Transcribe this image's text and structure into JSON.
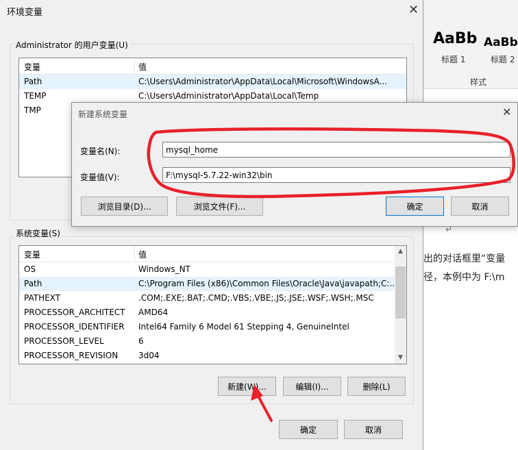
{
  "word": {
    "styles": [
      {
        "sample": "AaBb",
        "name": "标题 1"
      },
      {
        "sample": "AaBb",
        "name": "标题 2"
      }
    ],
    "group_label": "样式",
    "text_line1": "出的对话框里“变量",
    "text_line2": "径，本例中为 F:\\m"
  },
  "env": {
    "title": "环境变量",
    "user_group_label": "Administrator 的用户变量(U)",
    "columns": {
      "var": "变量",
      "val": "值"
    },
    "user_vars": [
      {
        "name": "Path",
        "value": "C:\\Users\\Administrator\\AppData\\Local\\Microsoft\\WindowsA..."
      },
      {
        "name": "TEMP",
        "value": "C:\\Users\\Administrator\\AppData\\Local\\Temp"
      },
      {
        "name": "TMP",
        "value": ""
      }
    ],
    "system_group_label": "系统变量(S)",
    "system_vars": [
      {
        "name": "OS",
        "value": "Windows_NT"
      },
      {
        "name": "Path",
        "value": "C:\\Program Files (x86)\\Common Files\\Oracle\\Java\\javapath;C:..."
      },
      {
        "name": "PATHEXT",
        "value": ".COM;.EXE;.BAT;.CMD;.VBS;.VBE;.JS;.JSE;.WSF;.WSH;.MSC"
      },
      {
        "name": "PROCESSOR_ARCHITECT",
        "value": "AMD64"
      },
      {
        "name": "PROCESSOR_IDENTIFIER",
        "value": "Intel64 Family 6 Model 61 Stepping 4, GenuineIntel"
      },
      {
        "name": "PROCESSOR_LEVEL",
        "value": "6"
      },
      {
        "name": "PROCESSOR_REVISION",
        "value": "3d04"
      }
    ],
    "buttons": {
      "new": "新建(W)...",
      "edit": "编辑(I)...",
      "delete": "删除(L)"
    },
    "ok": "确定",
    "cancel": "取消"
  },
  "new_var": {
    "title": "新建系统变量",
    "name_label": "变量名(N):",
    "name_value": "mysql_home",
    "value_label": "变量值(V):",
    "value_value": "F:\\mysql-5.7.22-win32\\bin",
    "browse_dir": "浏览目录(D)...",
    "browse_file": "浏览文件(F)...",
    "ok": "确定",
    "cancel": "取消"
  },
  "colors": {
    "annotation": "#e8202a",
    "selection": "#e5f3ff",
    "focus": "#0078d7"
  }
}
